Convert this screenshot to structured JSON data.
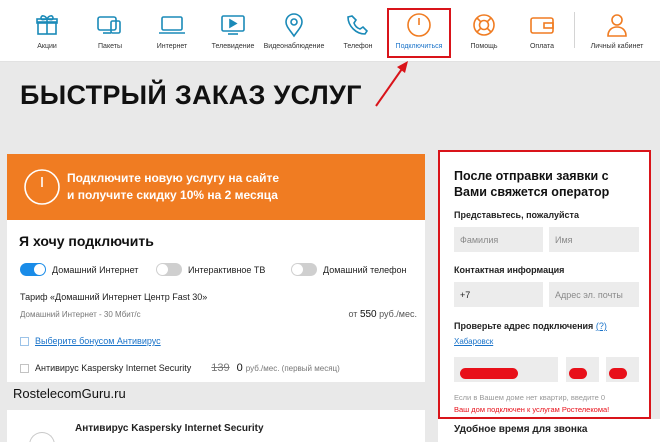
{
  "nav": {
    "items": [
      {
        "label": "Акции",
        "icon": "gift-icon"
      },
      {
        "label": "Пакеты",
        "icon": "packages-icon"
      },
      {
        "label": "Интернет",
        "icon": "laptop-icon"
      },
      {
        "label": "Телевидение",
        "icon": "tv-icon"
      },
      {
        "label": "Видеонаблюдение",
        "icon": "camera-pin-icon"
      },
      {
        "label": "Телефон",
        "icon": "phone-icon"
      },
      {
        "label": "Подключиться",
        "icon": "power-icon"
      },
      {
        "label": "Помощь",
        "icon": "lifebuoy-icon"
      },
      {
        "label": "Оплата",
        "icon": "wallet-icon"
      },
      {
        "label": "Личный кабинет",
        "icon": "user-icon"
      }
    ],
    "active_index": 6
  },
  "page_title": "БЫСТРЫЙ ЗАКАЗ УСЛУГ",
  "promo": {
    "line1": "Подключите новую услугу на сайте",
    "line2": "и получите скидку 10% на 2 месяца"
  },
  "order": {
    "heading": "Я хочу подключить",
    "toggles": [
      {
        "label": "Домашний Интернет",
        "on": true
      },
      {
        "label": "Интерактивное ТВ",
        "on": false
      },
      {
        "label": "Домашний телефон",
        "on": false
      }
    ],
    "tariff": "Тариф «Домашний Интернет Центр Fast 30»",
    "speed": "Домашний Интернет - 30 Мбит/с",
    "price_prefix": "от",
    "price_value": "550",
    "price_unit": "руб./мес.",
    "bonus_link": "Выберите бонусом Антивирус",
    "antivirus": {
      "name": "Антивирус Kaspersky Internet Security",
      "old_price": "139",
      "new_price": "0",
      "unit": "руб./мес. (первый месяц)"
    }
  },
  "watermark": "RostelecomGuru.ru",
  "bottom_card": {
    "title": "Антивирус Kaspersky Internet Security"
  },
  "form": {
    "title": "После отправки заявки с Вами свяжется оператор",
    "intro_label": "Представьтесь, пожалуйста",
    "surname_placeholder": "Фамилия",
    "name_placeholder": "Имя",
    "contact_label": "Контактная информация",
    "phone_value": "+7",
    "email_placeholder": "Адрес эл. почты",
    "address_label": "Проверьте адрес подключения",
    "help_link": "(?)",
    "city": "Хабаровск",
    "note": "Если в Вашем доме нет квартир, введите 0",
    "status": "Ваш дом подключен к услугам Ростелекома!",
    "next_section": "Удобное время для звонка"
  },
  "colors": {
    "accent_orange": "#f07c22",
    "highlight_red": "#d9141a",
    "link_blue": "#1a73c9",
    "toggle_on": "#1a8ce8"
  }
}
